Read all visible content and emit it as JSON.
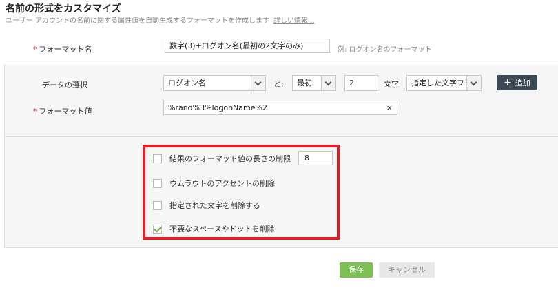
{
  "header": {
    "title": "名前の形式をカスタマイズ",
    "subtitle": "ユーザー アカウントの名前に関する属性値を自動生成するフォーマットを作成します",
    "details_link": "詳しい情報..."
  },
  "format_name": {
    "label": "フォーマット名",
    "required_mark": "*",
    "value": "数字(3)+ログオン名(最初の2文字のみ)",
    "example": "例: ログオン名のフォーマット"
  },
  "data_selection": {
    "label": "データの選択",
    "attribute_select": "ログオン名",
    "and_label": "と:",
    "position_select": "最初",
    "count_value": "2",
    "chars_label": "文字",
    "mode_select": "指定した文字フォ",
    "add_button": "追加"
  },
  "format_value": {
    "label": "フォーマット値",
    "required_mark": "*",
    "value": "%rand%3%logonName%2",
    "clear_icon": "×"
  },
  "options": [
    {
      "label": "結果のフォーマット値の長さの制限",
      "checked": false
    },
    {
      "label": "ウムラウトのアクセントの削除",
      "checked": false
    },
    {
      "label": "指定された文字を削除する",
      "checked": false
    },
    {
      "label": "不要なスペースやドットを削除",
      "checked": true
    }
  ],
  "length_limit_value": "8",
  "footer": {
    "save": "保存",
    "cancel": "キャンセル"
  },
  "colors": {
    "highlight_box": "#e51e25",
    "save_button": "#7cbf52",
    "add_button": "#3d4a55",
    "required_star": "#e02525"
  }
}
